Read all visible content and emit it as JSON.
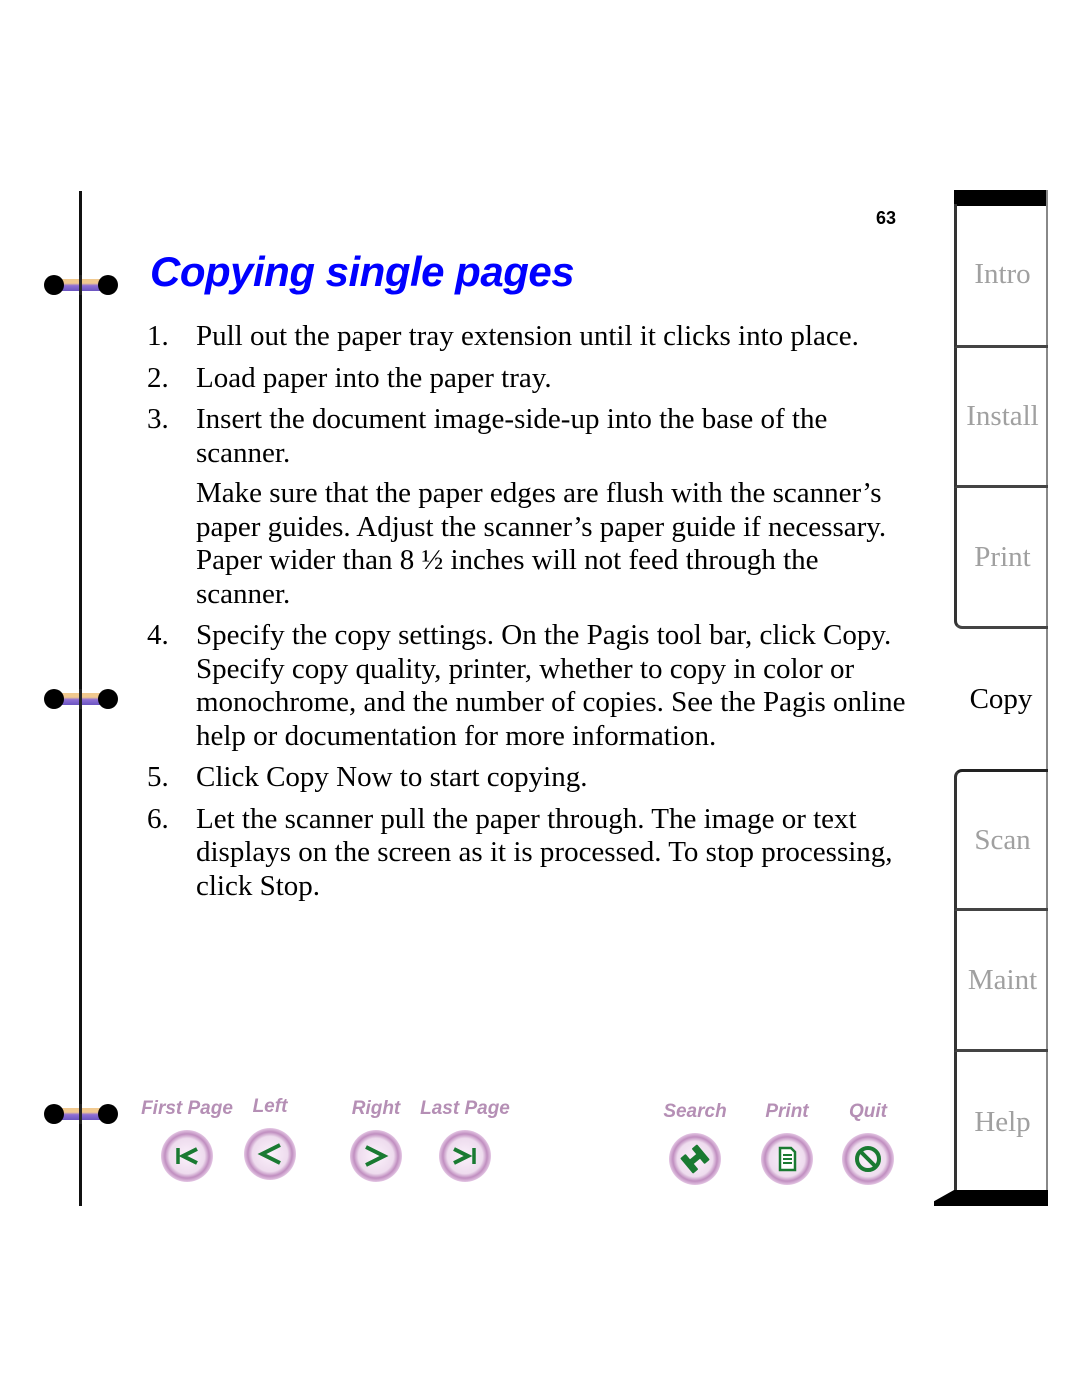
{
  "page": {
    "number": "63",
    "title": "Copying single pages",
    "title_color": "#0000ff"
  },
  "steps": [
    {
      "num": "1.",
      "text": "Pull out the paper tray extension until it clicks into place."
    },
    {
      "num": "2.",
      "text": "Load paper into the paper tray."
    },
    {
      "num": "3.",
      "text": "Insert the document image-side-up into the base of the scanner.",
      "note": "Make sure that the paper edges are flush with the scanner’s paper guides. Adjust the scanner’s paper guide if necessary. Paper wider than 8 ½ inches will not feed through the scanner."
    },
    {
      "num": "4.",
      "text": "Specify the copy settings. On the Pagis tool bar, click Copy. Specify copy quality, printer, whether to copy in color or monochrome, and the number of copies. See the Pagis online help or documentation for more information."
    },
    {
      "num": "5.",
      "text": "Click Copy Now to start copying."
    },
    {
      "num": "6.",
      "text": "Let the scanner pull the paper through. The image or text displays on the screen as it is processed. To stop processing, click Stop."
    }
  ],
  "tabs": [
    {
      "label": "Intro",
      "active": false
    },
    {
      "label": "Install",
      "active": false
    },
    {
      "label": "Print",
      "active": false
    },
    {
      "label": "Copy",
      "active": true
    },
    {
      "label": "Scan",
      "active": false
    },
    {
      "label": "Maint",
      "active": false
    },
    {
      "label": "Help",
      "active": false
    }
  ],
  "nav": {
    "first_page": {
      "label": "First Page",
      "icon": "first-page-icon"
    },
    "left": {
      "label": "Left",
      "icon": "arrow-left-icon"
    },
    "right": {
      "label": "Right",
      "icon": "arrow-right-icon"
    },
    "last_page": {
      "label": "Last Page",
      "icon": "last-page-icon"
    },
    "search": {
      "label": "Search",
      "icon": "binoculars-icon"
    },
    "print": {
      "label": "Print",
      "icon": "document-icon"
    },
    "quit": {
      "label": "Quit",
      "icon": "no-entry-icon"
    },
    "icon_color": "#1a7a32",
    "label_color": "#b58fb5"
  }
}
